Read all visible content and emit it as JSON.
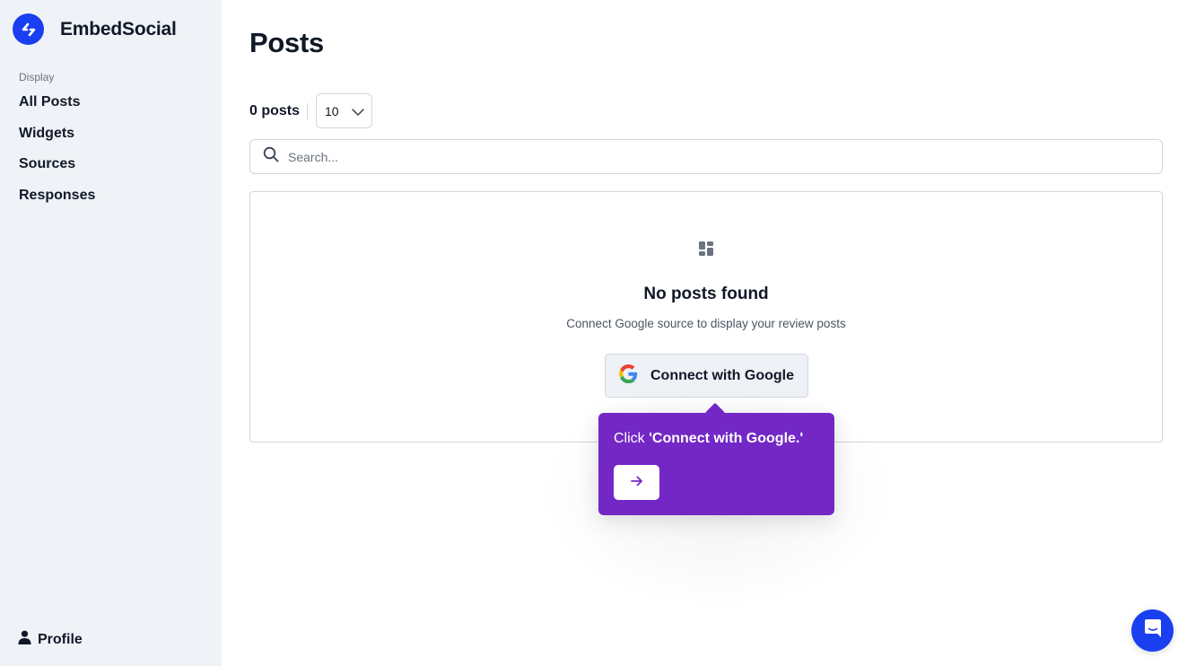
{
  "app": {
    "brand_name": "EmbedSocial",
    "brand_color": "#1a3ff0",
    "logo_icon": "embedsocial-logo-icon"
  },
  "sidebar": {
    "section_label": "Display",
    "items": [
      {
        "label": "All Posts"
      },
      {
        "label": "Widgets"
      },
      {
        "label": "Sources"
      },
      {
        "label": "Responses"
      }
    ],
    "profile_label": "Profile",
    "profile_icon": "user-icon",
    "background": "#eff2f6"
  },
  "main": {
    "title": "Posts",
    "post_count": "0 posts",
    "per_page": {
      "selected": "10",
      "icon": "chevron-down-icon"
    },
    "search": {
      "placeholder": "Search...",
      "value": "",
      "icon": "search-icon"
    },
    "empty_state": {
      "icon": "dashboard-grid-icon",
      "title": "No posts found",
      "description": "Connect Google source to display your review posts",
      "button_label": "Connect with Google",
      "button_icon": "google-g-icon"
    }
  },
  "tour": {
    "prefix": "Click ",
    "highlight": "'Connect with Google.'",
    "next_icon": "arrow-right-icon",
    "background": "#7327c5"
  },
  "chat": {
    "icon": "chat-bubble-icon"
  }
}
